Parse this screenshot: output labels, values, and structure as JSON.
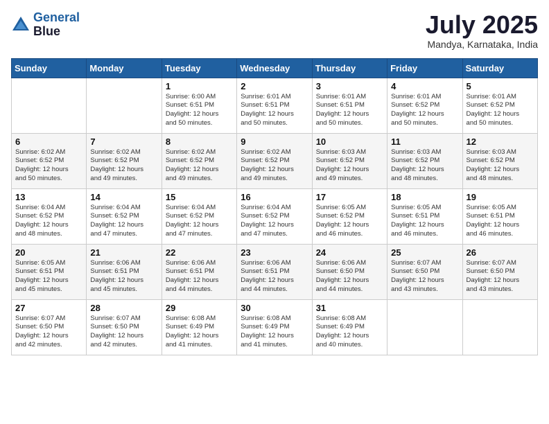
{
  "header": {
    "logo_line1": "General",
    "logo_line2": "Blue",
    "month_title": "July 2025",
    "location": "Mandya, Karnataka, India"
  },
  "weekdays": [
    "Sunday",
    "Monday",
    "Tuesday",
    "Wednesday",
    "Thursday",
    "Friday",
    "Saturday"
  ],
  "weeks": [
    [
      {
        "day": "",
        "info": ""
      },
      {
        "day": "",
        "info": ""
      },
      {
        "day": "1",
        "info": "Sunrise: 6:00 AM\nSunset: 6:51 PM\nDaylight: 12 hours\nand 50 minutes."
      },
      {
        "day": "2",
        "info": "Sunrise: 6:01 AM\nSunset: 6:51 PM\nDaylight: 12 hours\nand 50 minutes."
      },
      {
        "day": "3",
        "info": "Sunrise: 6:01 AM\nSunset: 6:51 PM\nDaylight: 12 hours\nand 50 minutes."
      },
      {
        "day": "4",
        "info": "Sunrise: 6:01 AM\nSunset: 6:52 PM\nDaylight: 12 hours\nand 50 minutes."
      },
      {
        "day": "5",
        "info": "Sunrise: 6:01 AM\nSunset: 6:52 PM\nDaylight: 12 hours\nand 50 minutes."
      }
    ],
    [
      {
        "day": "6",
        "info": "Sunrise: 6:02 AM\nSunset: 6:52 PM\nDaylight: 12 hours\nand 50 minutes."
      },
      {
        "day": "7",
        "info": "Sunrise: 6:02 AM\nSunset: 6:52 PM\nDaylight: 12 hours\nand 49 minutes."
      },
      {
        "day": "8",
        "info": "Sunrise: 6:02 AM\nSunset: 6:52 PM\nDaylight: 12 hours\nand 49 minutes."
      },
      {
        "day": "9",
        "info": "Sunrise: 6:02 AM\nSunset: 6:52 PM\nDaylight: 12 hours\nand 49 minutes."
      },
      {
        "day": "10",
        "info": "Sunrise: 6:03 AM\nSunset: 6:52 PM\nDaylight: 12 hours\nand 49 minutes."
      },
      {
        "day": "11",
        "info": "Sunrise: 6:03 AM\nSunset: 6:52 PM\nDaylight: 12 hours\nand 48 minutes."
      },
      {
        "day": "12",
        "info": "Sunrise: 6:03 AM\nSunset: 6:52 PM\nDaylight: 12 hours\nand 48 minutes."
      }
    ],
    [
      {
        "day": "13",
        "info": "Sunrise: 6:04 AM\nSunset: 6:52 PM\nDaylight: 12 hours\nand 48 minutes."
      },
      {
        "day": "14",
        "info": "Sunrise: 6:04 AM\nSunset: 6:52 PM\nDaylight: 12 hours\nand 47 minutes."
      },
      {
        "day": "15",
        "info": "Sunrise: 6:04 AM\nSunset: 6:52 PM\nDaylight: 12 hours\nand 47 minutes."
      },
      {
        "day": "16",
        "info": "Sunrise: 6:04 AM\nSunset: 6:52 PM\nDaylight: 12 hours\nand 47 minutes."
      },
      {
        "day": "17",
        "info": "Sunrise: 6:05 AM\nSunset: 6:52 PM\nDaylight: 12 hours\nand 46 minutes."
      },
      {
        "day": "18",
        "info": "Sunrise: 6:05 AM\nSunset: 6:51 PM\nDaylight: 12 hours\nand 46 minutes."
      },
      {
        "day": "19",
        "info": "Sunrise: 6:05 AM\nSunset: 6:51 PM\nDaylight: 12 hours\nand 46 minutes."
      }
    ],
    [
      {
        "day": "20",
        "info": "Sunrise: 6:05 AM\nSunset: 6:51 PM\nDaylight: 12 hours\nand 45 minutes."
      },
      {
        "day": "21",
        "info": "Sunrise: 6:06 AM\nSunset: 6:51 PM\nDaylight: 12 hours\nand 45 minutes."
      },
      {
        "day": "22",
        "info": "Sunrise: 6:06 AM\nSunset: 6:51 PM\nDaylight: 12 hours\nand 44 minutes."
      },
      {
        "day": "23",
        "info": "Sunrise: 6:06 AM\nSunset: 6:51 PM\nDaylight: 12 hours\nand 44 minutes."
      },
      {
        "day": "24",
        "info": "Sunrise: 6:06 AM\nSunset: 6:50 PM\nDaylight: 12 hours\nand 44 minutes."
      },
      {
        "day": "25",
        "info": "Sunrise: 6:07 AM\nSunset: 6:50 PM\nDaylight: 12 hours\nand 43 minutes."
      },
      {
        "day": "26",
        "info": "Sunrise: 6:07 AM\nSunset: 6:50 PM\nDaylight: 12 hours\nand 43 minutes."
      }
    ],
    [
      {
        "day": "27",
        "info": "Sunrise: 6:07 AM\nSunset: 6:50 PM\nDaylight: 12 hours\nand 42 minutes."
      },
      {
        "day": "28",
        "info": "Sunrise: 6:07 AM\nSunset: 6:50 PM\nDaylight: 12 hours\nand 42 minutes."
      },
      {
        "day": "29",
        "info": "Sunrise: 6:08 AM\nSunset: 6:49 PM\nDaylight: 12 hours\nand 41 minutes."
      },
      {
        "day": "30",
        "info": "Sunrise: 6:08 AM\nSunset: 6:49 PM\nDaylight: 12 hours\nand 41 minutes."
      },
      {
        "day": "31",
        "info": "Sunrise: 6:08 AM\nSunset: 6:49 PM\nDaylight: 12 hours\nand 40 minutes."
      },
      {
        "day": "",
        "info": ""
      },
      {
        "day": "",
        "info": ""
      }
    ]
  ]
}
